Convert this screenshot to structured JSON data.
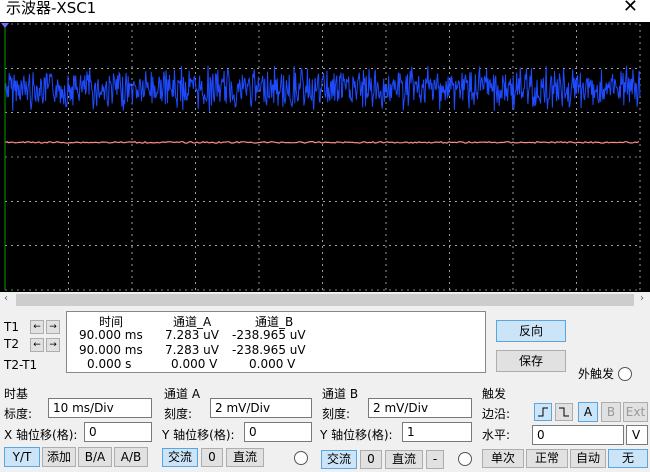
{
  "window": {
    "title": "示波器-XSC1",
    "close_glyph": "✕"
  },
  "scrollbar": {
    "left_glyph": "‹",
    "right_glyph": "›"
  },
  "readout": {
    "headers": {
      "time": "时间",
      "ch_a": "通道_A",
      "ch_b": "通道_B"
    },
    "rows": [
      {
        "label": "T1",
        "time": "90.000 ms",
        "a": "7.283 uV",
        "b": "-238.965 uV"
      },
      {
        "label": "T2",
        "time": "90.000 ms",
        "a": "7.283 uV",
        "b": "-238.965 uV"
      },
      {
        "label": "T2-T1",
        "time": "0.000 s",
        "a": "0.000 V",
        "b": "0.000 V"
      }
    ],
    "left_arrow": "←",
    "right_arrow": "→"
  },
  "buttons": {
    "reverse": "反向",
    "save": "保存",
    "ext_trigger": "外触发"
  },
  "timebase": {
    "section": "时基",
    "scale_label": "标度:",
    "scale_value": "10 ms/Div",
    "xpos_label": "X 轴位移(格):",
    "xpos_value": "0",
    "modes": [
      "Y/T",
      "添加",
      "B/A",
      "A/B"
    ]
  },
  "channel_a": {
    "section": "通道 A",
    "scale_label": "刻度:",
    "scale_value": "2 mV/Div",
    "ypos_label": "Y 轴位移(格):",
    "ypos_value": "0",
    "coupling": [
      "交流",
      "0",
      "直流"
    ]
  },
  "channel_b": {
    "section": "通道 B",
    "scale_label": "刻度:",
    "scale_value": "2 mV/Div",
    "ypos_label": "Y 轴位移(格):",
    "ypos_value": "1",
    "coupling": [
      "交流",
      "0",
      "直流",
      "-"
    ]
  },
  "trigger": {
    "section": "触发",
    "edge_label": "边沿:",
    "level_label": "水平:",
    "level_value": "0",
    "level_unit": "V",
    "sources": [
      "A",
      "B",
      "Ext"
    ],
    "modes": [
      "单次",
      "正常",
      "自动",
      "无"
    ]
  },
  "colors": {
    "screen": "#000000",
    "trace_a": "#1e4bff",
    "trace_b": "#ff8c8c",
    "grid": "#ffffff"
  }
}
